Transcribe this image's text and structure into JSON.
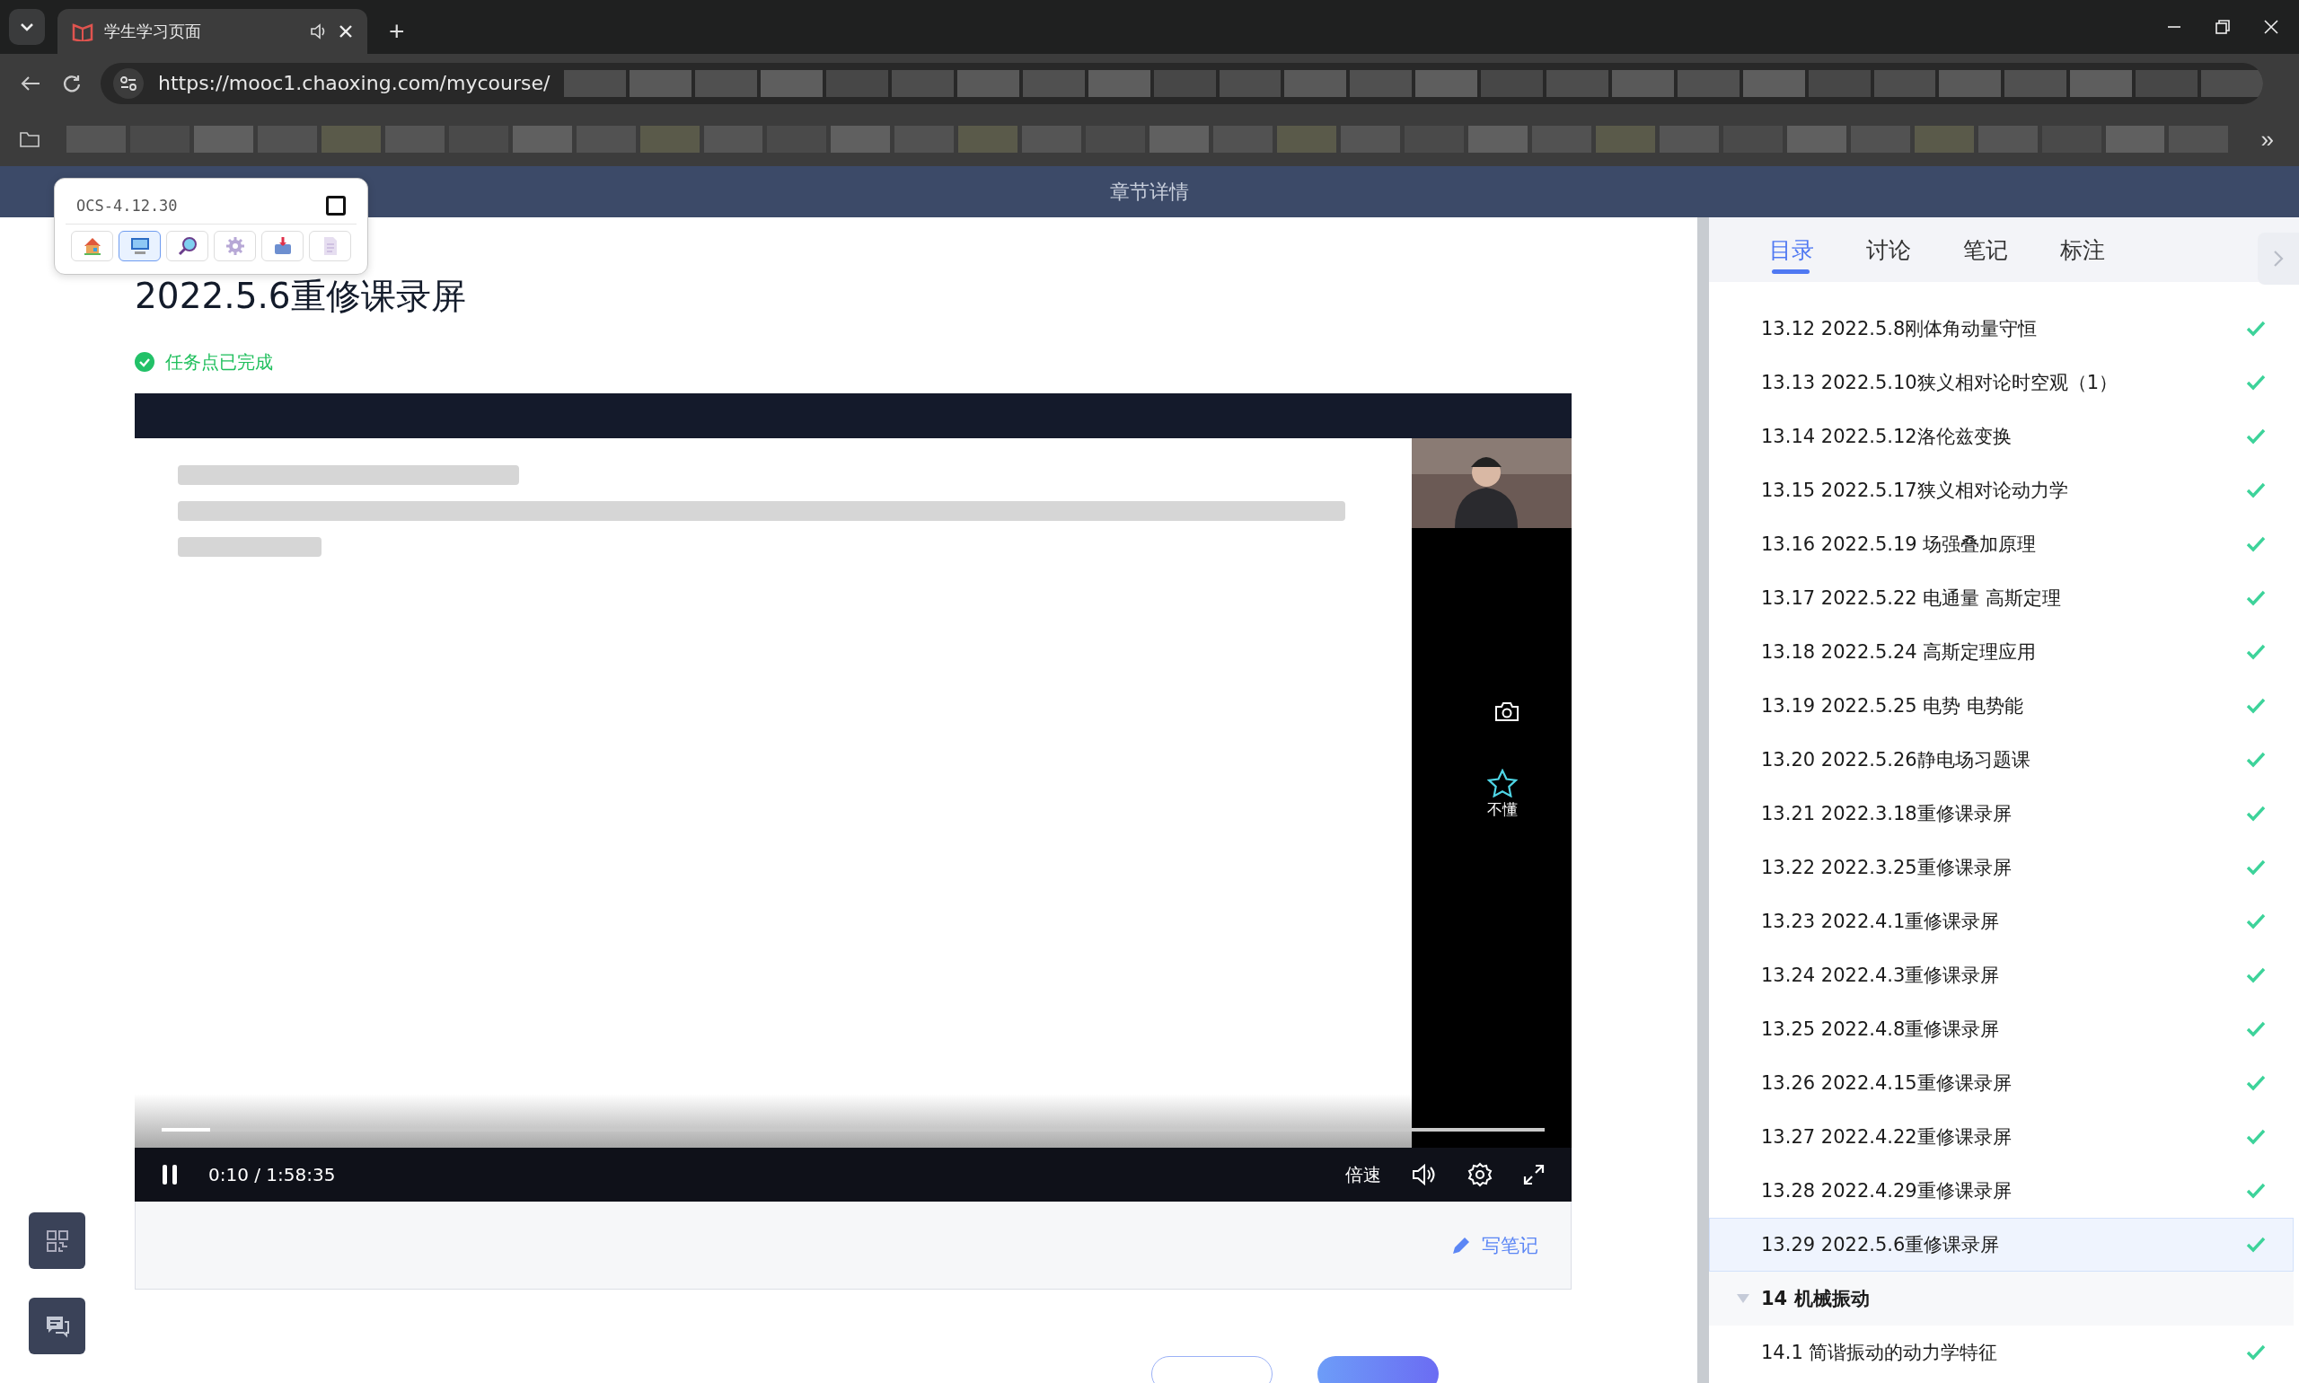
{
  "browser": {
    "tab": {
      "title": "学生学习页面"
    },
    "new_tab": "+",
    "url": "https://mooc1.chaoxing.com/mycourse/",
    "bookmarks_more": "»"
  },
  "header": {
    "title": "章节详情"
  },
  "ocs_panel": {
    "title": "OCS-4.12.30",
    "tools": [
      {
        "kind": "home",
        "selected": false
      },
      {
        "kind": "computer",
        "selected": true
      },
      {
        "kind": "search",
        "selected": false
      },
      {
        "kind": "settings",
        "selected": false
      },
      {
        "kind": "download",
        "selected": false
      },
      {
        "kind": "document",
        "selected": false
      }
    ]
  },
  "lesson": {
    "title": "2022.5.6重修课录屏",
    "status": "任务点已完成"
  },
  "player": {
    "kind": "picture",
    "playing": true,
    "level": 0.035,
    "time": "0:10 / 1:58:35",
    "speed": "倍速",
    "confused_label": "不懂"
  },
  "notes": {
    "write": "写笔记"
  },
  "side_tabs": [
    {
      "label": "目录",
      "selected": true
    },
    {
      "label": "讨论",
      "selected": false
    },
    {
      "label": "笔记",
      "selected": false
    },
    {
      "label": "标注",
      "selected": false
    }
  ],
  "chapters": [
    {
      "kind": "lesson",
      "title": "13.12 2022.5.8刚体角动量守恒",
      "done": true,
      "selected": false
    },
    {
      "kind": "lesson",
      "title": "13.13 2022.5.10狭义相对论时空观（1）",
      "done": true,
      "selected": false
    },
    {
      "kind": "lesson",
      "title": "13.14 2022.5.12洛伦兹变换",
      "done": true,
      "selected": false
    },
    {
      "kind": "lesson",
      "title": "13.15 2022.5.17狭义相对论动力学",
      "done": true,
      "selected": false
    },
    {
      "kind": "lesson",
      "title": "13.16 2022.5.19 场强叠加原理",
      "done": true,
      "selected": false
    },
    {
      "kind": "lesson",
      "title": "13.17 2022.5.22 电通量 高斯定理",
      "done": true,
      "selected": false
    },
    {
      "kind": "lesson",
      "title": "13.18 2022.5.24 高斯定理应用",
      "done": true,
      "selected": false
    },
    {
      "kind": "lesson",
      "title": "13.19 2022.5.25 电势 电势能",
      "done": true,
      "selected": false
    },
    {
      "kind": "lesson",
      "title": "13.20 2022.5.26静电场习题课",
      "done": true,
      "selected": false
    },
    {
      "kind": "lesson",
      "title": "13.21 2022.3.18重修课录屏",
      "done": true,
      "selected": false
    },
    {
      "kind": "lesson",
      "title": "13.22 2022.3.25重修课录屏",
      "done": true,
      "selected": false
    },
    {
      "kind": "lesson",
      "title": "13.23 2022.4.1重修课录屏",
      "done": true,
      "selected": false
    },
    {
      "kind": "lesson",
      "title": "13.24 2022.4.3重修课录屏",
      "done": true,
      "selected": false
    },
    {
      "kind": "lesson",
      "title": "13.25 2022.4.8重修课录屏",
      "done": true,
      "selected": false
    },
    {
      "kind": "lesson",
      "title": "13.26 2022.4.15重修课录屏",
      "done": true,
      "selected": false
    },
    {
      "kind": "lesson",
      "title": "13.27 2022.4.22重修课录屏",
      "done": true,
      "selected": false
    },
    {
      "kind": "lesson",
      "title": "13.28 2022.4.29重修课录屏",
      "done": true,
      "selected": false
    },
    {
      "kind": "lesson",
      "title": "13.29 2022.5.6重修课录屏",
      "done": true,
      "selected": true
    },
    {
      "kind": "section",
      "title": "14 机械振动",
      "expanded": true,
      "children": [
        {
          "kind": "lesson",
          "title": "14.1 简谐振动的动力学特征",
          "done": true,
          "selected": false
        }
      ]
    }
  ]
}
